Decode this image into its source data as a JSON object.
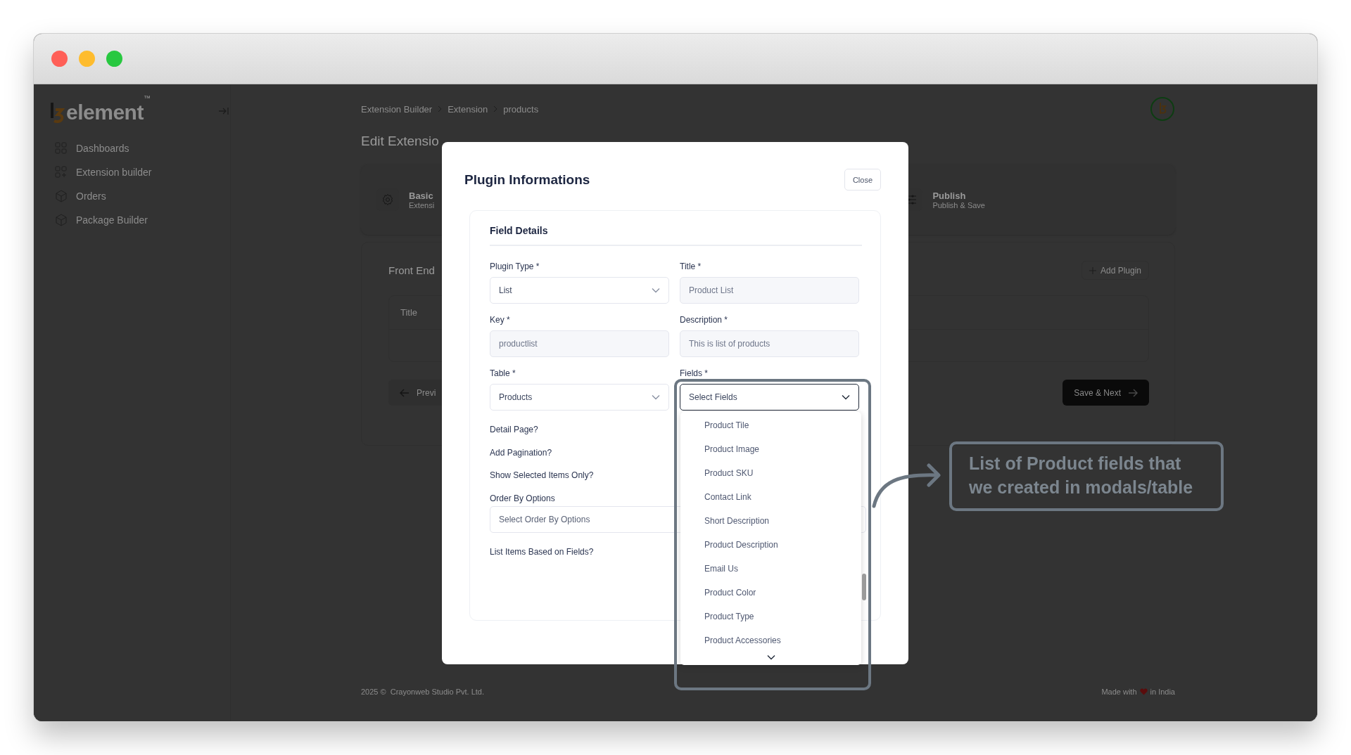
{
  "sidebar": {
    "logo": {
      "text": "element",
      "mark": "™"
    },
    "items": [
      {
        "label": "Dashboards",
        "kind": "grid"
      },
      {
        "label": "Extension builder",
        "kind": "grid-plus"
      },
      {
        "label": "Orders",
        "kind": "boxes"
      },
      {
        "label": "Package Builder",
        "kind": "boxes"
      }
    ]
  },
  "breadcrumb": [
    "Extension Builder",
    "Extension",
    "products"
  ],
  "page_title": "Edit Extensio",
  "steps": [
    {
      "title": "Basic",
      "subtitle": "Extensi",
      "kind": "gear"
    },
    {
      "title": "Publish",
      "subtitle": "Publish & Save",
      "kind": "sliders"
    }
  ],
  "section": {
    "title": "Front End",
    "add_button": "Add Plugin",
    "table": {
      "columns": [
        "Title"
      ]
    },
    "prev_button": "Previ",
    "next_button": "Save & Next"
  },
  "footer": {
    "copyright": "2025 ©  Crayonweb Studio Pvt. Ltd.",
    "made_with": [
      "Made with",
      "in India"
    ]
  },
  "modal": {
    "title": "Plugin Informations",
    "close": "Close",
    "section_title": "Field Details",
    "fields": [
      {
        "label": "Plugin Type *",
        "kind": "select",
        "value": "List"
      },
      {
        "label": "Title *",
        "kind": "input",
        "placeholder": "Product List",
        "disabled": true
      },
      {
        "label": "Key *",
        "kind": "input",
        "placeholder": "productlist",
        "disabled": true
      },
      {
        "label": "Description *",
        "kind": "input",
        "placeholder": "This is list of products",
        "disabled": true
      },
      {
        "label": "Table *",
        "kind": "select",
        "value": "Products"
      },
      {
        "label": "Fields *",
        "kind": "select",
        "placeholder": "Select Fields",
        "expanded": true,
        "options": [
          "Product Tile",
          "Product Image",
          "Product SKU",
          "Contact Link",
          "Short Description",
          "Product Description",
          "Email Us",
          "Product Color",
          "Product Type",
          "Product Accessories"
        ]
      }
    ],
    "toggles": [
      "Detail Page?",
      "Add Pagination?",
      "Show Selected Items Only?"
    ],
    "order_by": {
      "label": "Order By Options",
      "placeholder": "Select Order By Options"
    },
    "list_items_label": "List Items Based on Fields?"
  },
  "callout": {
    "text": "List of Product fields that we created in modals/table"
  }
}
